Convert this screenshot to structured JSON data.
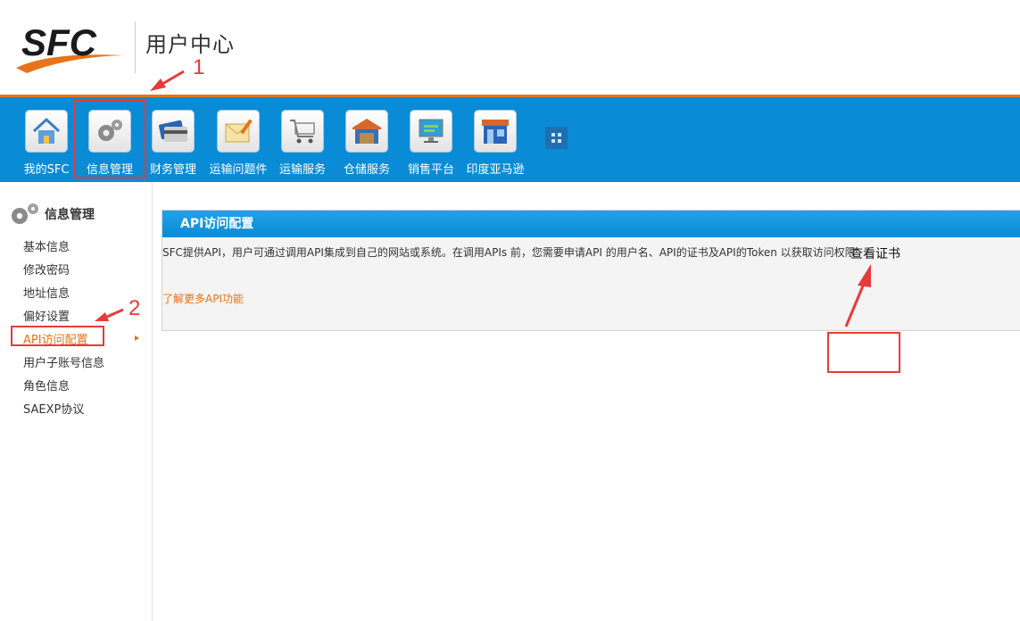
{
  "header": {
    "logo_text": "SFC",
    "title": "用户中心"
  },
  "topnav": {
    "items": [
      {
        "label": "我的SFC",
        "icon": "home-icon"
      },
      {
        "label": "信息管理",
        "icon": "gears-icon"
      },
      {
        "label": "财务管理",
        "icon": "credit-card-icon"
      },
      {
        "label": "运输问题件",
        "icon": "envelope-pencil-icon"
      },
      {
        "label": "运输服务",
        "icon": "shopping-cart-icon"
      },
      {
        "label": "仓储服务",
        "icon": "warehouse-icon"
      },
      {
        "label": "销售平台",
        "icon": "monitor-icon"
      },
      {
        "label": "印度亚马逊",
        "icon": "storefront-icon"
      }
    ],
    "more_icon": "grid-icon"
  },
  "sidebar": {
    "title": "信息管理",
    "items": [
      {
        "label": "基本信息"
      },
      {
        "label": "修改密码"
      },
      {
        "label": "地址信息"
      },
      {
        "label": "偏好设置"
      },
      {
        "label": "API访问配置"
      },
      {
        "label": "用户子账号信息"
      },
      {
        "label": "角色信息"
      },
      {
        "label": "SAEXP协议"
      }
    ],
    "active_index": 4
  },
  "panel": {
    "title": "API访问配置",
    "description": "SFC提供API，用户可通过调用API集成到自己的网站或系统。在调用APIs 前，您需要申请API 的用户名、API的证书及API的Token 以获取访问权限",
    "view_cert": "查看证书",
    "learn_more": "了解更多API功能"
  },
  "annotations": {
    "marker_1": "1",
    "marker_2": "2",
    "color": "#e83a3a"
  },
  "colors": {
    "nav_bg": "#0a8bd6",
    "accent_orange": "#e8731a",
    "panel_header": "#0b8bd6"
  }
}
